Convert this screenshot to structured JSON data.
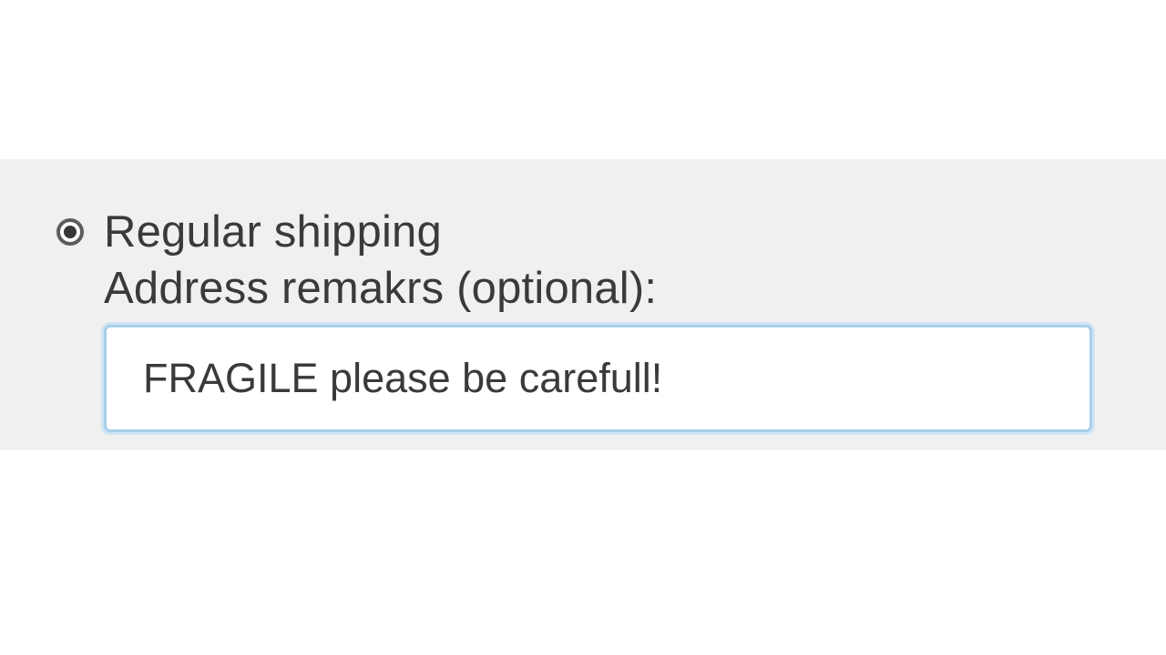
{
  "shipping": {
    "option_label": "Regular shipping",
    "remarks_label": "Address remakrs (optional):",
    "remarks_value": "FRAGILE please be carefull!"
  }
}
